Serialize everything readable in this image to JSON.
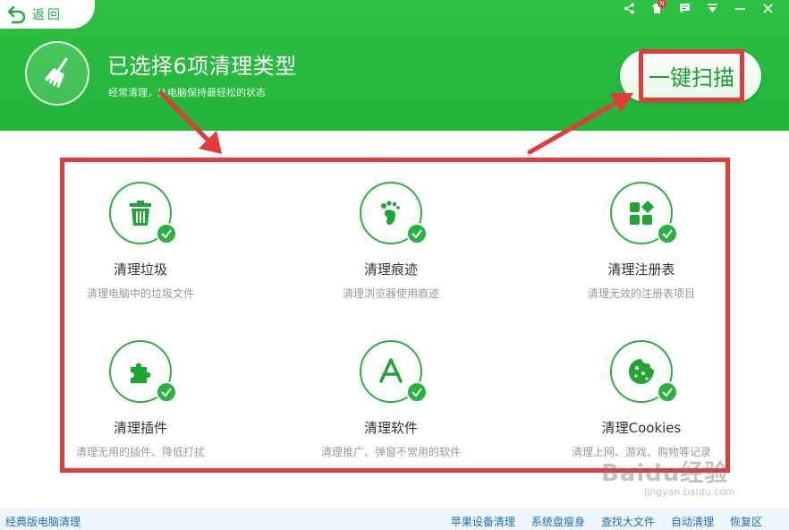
{
  "header": {
    "back_label": "返回",
    "title": "已选择6项清理类型",
    "subtitle": "经常清理，让电脑保持最轻松的状态",
    "scan_button": "一键扫描",
    "notify_badge": "N"
  },
  "window_controls": [
    "share-icon",
    "skin-icon",
    "message-icon",
    "menu-icon",
    "minimize-icon",
    "close-icon"
  ],
  "items": [
    {
      "name": "清理垃圾",
      "desc": "清理电脑中的垃圾文件",
      "icon": "trash-icon"
    },
    {
      "name": "清理痕迹",
      "desc": "清理浏览器使用痕迹",
      "icon": "footprint-icon"
    },
    {
      "name": "清理注册表",
      "desc": "清理无效的注册表项目",
      "icon": "registry-icon"
    },
    {
      "name": "清理插件",
      "desc": "清理无用的插件、降低打扰",
      "icon": "puzzle-icon"
    },
    {
      "name": "清理软件",
      "desc": "清理推广、弹窗不常用的软件",
      "icon": "app-store-icon"
    },
    {
      "name": "清理Cookies",
      "desc": "清理上网、游戏、购物等记录",
      "icon": "cookie-icon"
    }
  ],
  "footer": {
    "left": "经典版电脑清理",
    "links": [
      "苹果设备清理",
      "系统盘瘦身",
      "查找大文件",
      "自动清理",
      "恢复区"
    ]
  },
  "watermark": {
    "main": "Baidu经验",
    "sub": "jingyan.baidu.com"
  },
  "colors": {
    "brand_green": "#22b33a",
    "highlight_red": "#e33b3b",
    "link_blue": "#1e6fba"
  }
}
